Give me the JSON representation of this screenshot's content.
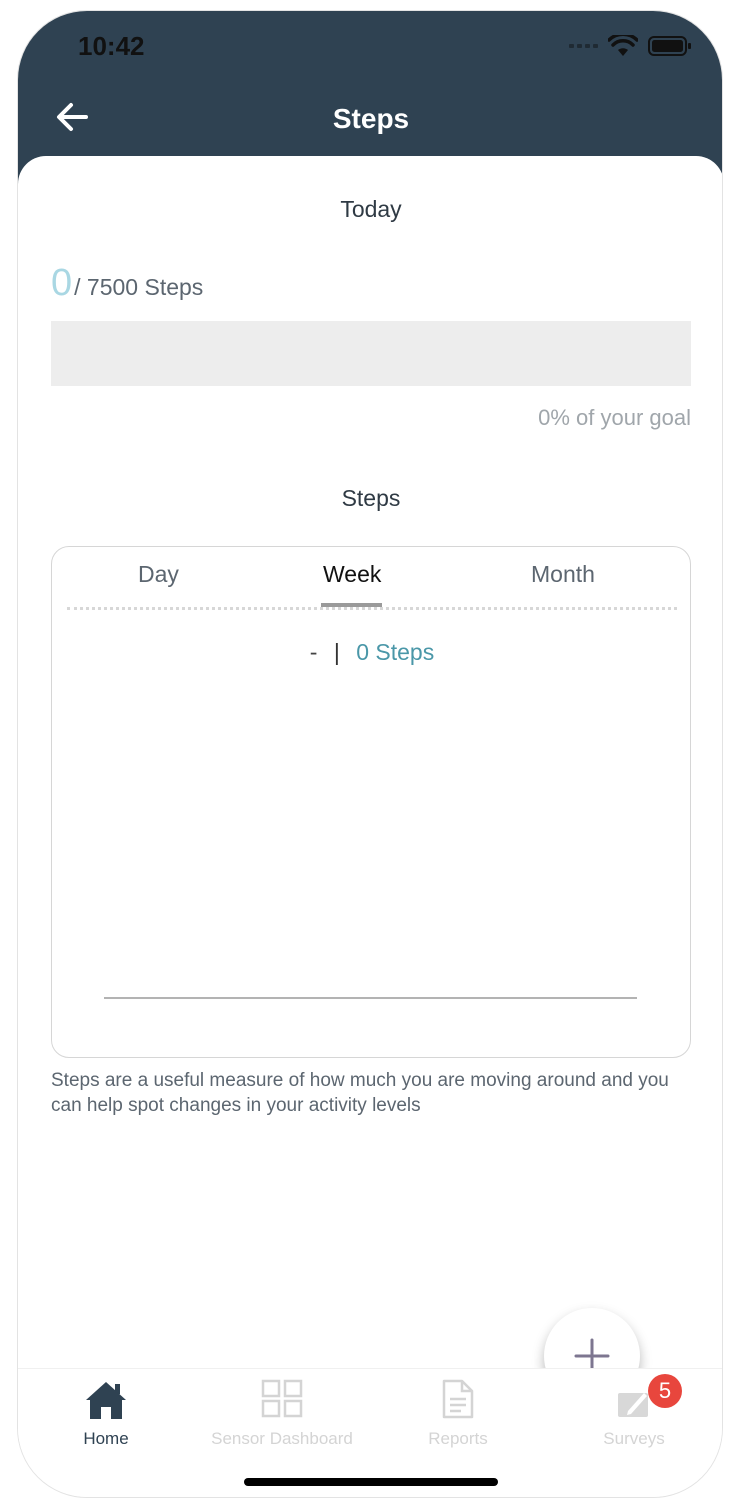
{
  "status_bar": {
    "time": "10:42"
  },
  "header": {
    "title": "Steps"
  },
  "today": {
    "label": "Today",
    "current_steps": "0",
    "goal_text": "/ 7500 Steps",
    "progress_fraction": 0,
    "goal_percent_text": "0% of your goal"
  },
  "chart_section": {
    "title": "Steps",
    "tabs": [
      "Day",
      "Week",
      "Month"
    ],
    "active_tab": "Week",
    "range_date": "-",
    "range_separator": "|",
    "range_value": "0 Steps"
  },
  "note": "Steps are a useful measure of how much you are moving around and you can help spot changes in your activity levels",
  "fab": {
    "icon": "plus-icon"
  },
  "tabbar": {
    "items": [
      {
        "label": "Home",
        "icon": "home-icon",
        "active": true
      },
      {
        "label": "Sensor Dashboard",
        "icon": "grid-icon",
        "active": false
      },
      {
        "label": "Reports",
        "icon": "document-icon",
        "active": false
      },
      {
        "label": "Surveys",
        "icon": "pencil-icon",
        "active": false,
        "badge": "5"
      }
    ]
  },
  "colors": {
    "header_bg": "#2f4252",
    "accent": "#4a97a8",
    "progress_light": "#a9d7e3",
    "badge": "#e8463d"
  }
}
